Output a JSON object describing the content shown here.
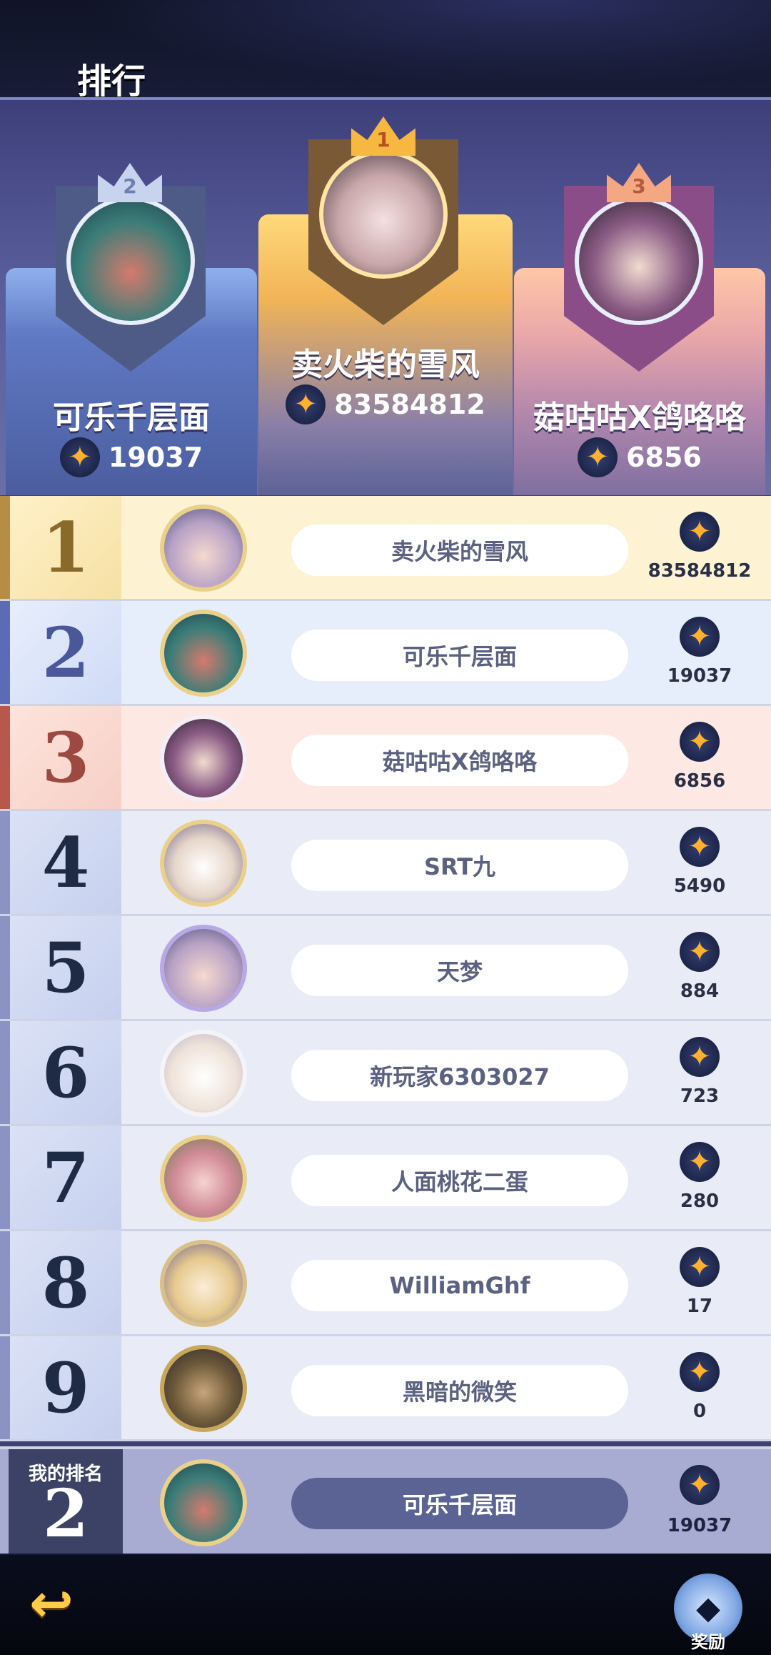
{
  "header": {
    "title": "排行"
  },
  "podium": [
    {
      "place": "2",
      "name": "可乐千层面",
      "score": "19037"
    },
    {
      "place": "1",
      "name": "卖火柴的雪风",
      "score": "83584812"
    },
    {
      "place": "3",
      "name": "菇咕咕X鸽咯咯",
      "score": "6856"
    }
  ],
  "rows": [
    {
      "rank": "1",
      "name": "卖火柴的雪风",
      "score": "83584812"
    },
    {
      "rank": "2",
      "name": "可乐千层面",
      "score": "19037"
    },
    {
      "rank": "3",
      "name": "菇咕咕X鸽咯咯",
      "score": "6856"
    },
    {
      "rank": "4",
      "name": "SRT九",
      "score": "5490"
    },
    {
      "rank": "5",
      "name": "天梦",
      "score": "884"
    },
    {
      "rank": "6",
      "name": "新玩家6303027",
      "score": "723"
    },
    {
      "rank": "7",
      "name": "人面桃花二蛋",
      "score": "280"
    },
    {
      "rank": "8",
      "name": "WilliamGhf",
      "score": "17"
    },
    {
      "rank": "9",
      "name": "黑暗的微笑",
      "score": "0"
    }
  ],
  "my_rank": {
    "label": "我的排名",
    "rank": "2",
    "name": "可乐千层面",
    "score": "19037"
  },
  "icons": {
    "coin": "star-coin-icon",
    "back": "back-arrow-icon",
    "reward": "diamond-icon"
  },
  "bottom": {
    "reward_label": "奖励"
  },
  "glyphs": {
    "star": "✦",
    "back": "↩",
    "diamond": "◆"
  }
}
